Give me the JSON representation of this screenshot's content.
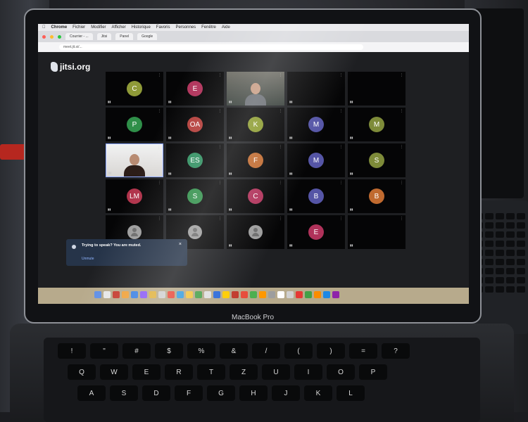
{
  "menubar": {
    "items": [
      "Chrome",
      "Fichier",
      "Modifier",
      "Afficher",
      "Historique",
      "Favoris",
      "Personnes",
      "Fenêtre",
      "Aide"
    ]
  },
  "browser": {
    "tabs": [
      "Courrier - ...",
      "Jitsi",
      "Panel",
      "Google"
    ],
    "url": "meet.jit.si/..."
  },
  "app": {
    "logo": "jitsi.org",
    "tiles": [
      {
        "initials": "C",
        "color": "#8f9a38"
      },
      {
        "initials": "E",
        "color": "#b0325a"
      },
      {
        "initials": "",
        "color": "",
        "video": true
      },
      {
        "initials": "",
        "color": "#8fa0c0"
      },
      {
        "initials": "",
        "color": ""
      },
      {
        "initials": "P",
        "color": "#2f8f49"
      },
      {
        "initials": "OA",
        "color": "#b43e3a"
      },
      {
        "initials": "K",
        "color": "#8a9a2c"
      },
      {
        "initials": "M",
        "color": "#5555a6"
      },
      {
        "initials": "M",
        "color": "#7e8b39"
      },
      {
        "initials": "",
        "color": "",
        "video2": true
      },
      {
        "initials": "ES",
        "color": "#2f8f60"
      },
      {
        "initials": "F",
        "color": "#c06a2f"
      },
      {
        "initials": "M",
        "color": "#5555a6"
      },
      {
        "initials": "S",
        "color": "#7e8b39"
      },
      {
        "initials": "LM",
        "color": "#b0324a"
      },
      {
        "initials": "S",
        "color": "#2f8f49"
      },
      {
        "initials": "C",
        "color": "#b0325a"
      },
      {
        "initials": "B",
        "color": "#5555a6"
      },
      {
        "initials": "B",
        "color": "#c06a2f"
      },
      {
        "initials": "",
        "color": "",
        "placeholder": true
      },
      {
        "initials": "",
        "color": "",
        "placeholder": true
      },
      {
        "initials": "",
        "color": "",
        "placeholder": true
      },
      {
        "initials": "E",
        "color": "#b0325a"
      },
      {
        "initials": "",
        "color": ""
      }
    ],
    "toast": {
      "title": "Trying to speak? You are muted.",
      "action": "Unmute",
      "close": "×"
    }
  },
  "laptop": {
    "brand": "MacBook Pro"
  },
  "keyboard": {
    "row1": [
      "!",
      "\"",
      "#",
      "$",
      "%",
      "&",
      "/",
      "(",
      ")",
      "=",
      "?"
    ],
    "row2": [
      "Q",
      "W",
      "E",
      "R",
      "T",
      "Z",
      "U",
      "I",
      "O",
      "P"
    ],
    "row3": [
      "A",
      "S",
      "D",
      "F",
      "G",
      "H",
      "J",
      "K",
      "L"
    ]
  }
}
